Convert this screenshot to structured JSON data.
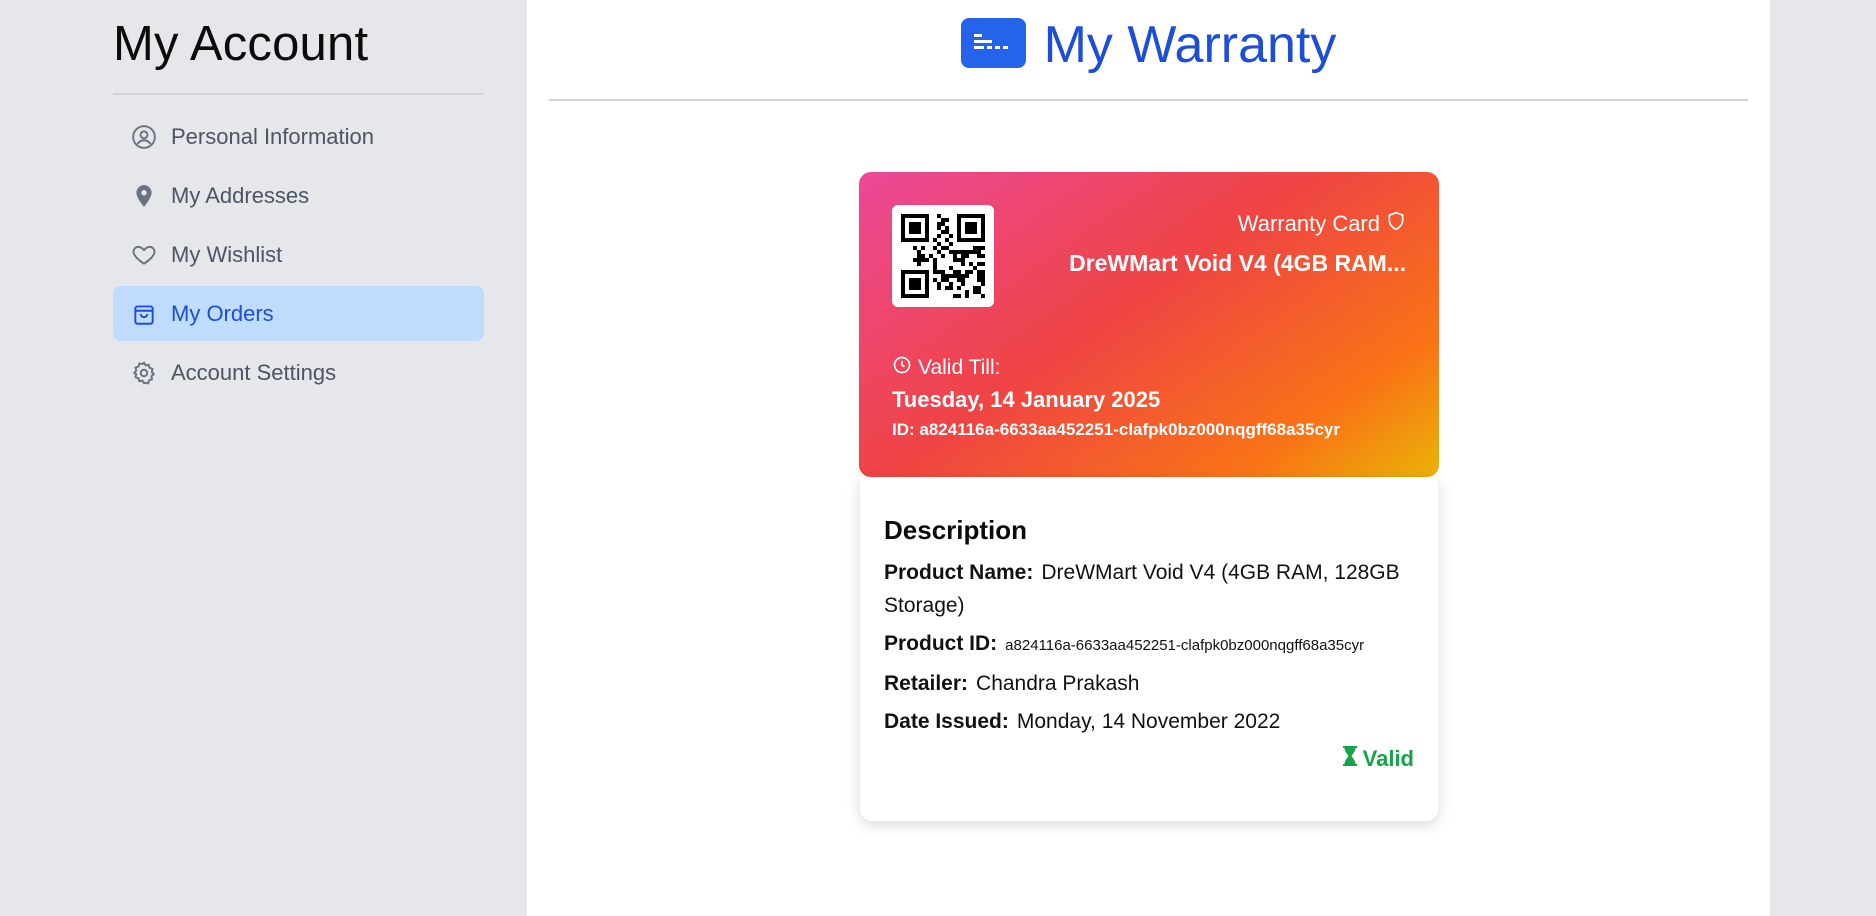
{
  "sidebar": {
    "title": "My Account",
    "items": [
      {
        "label": "Personal Information",
        "icon": "user-circle-icon"
      },
      {
        "label": "My Addresses",
        "icon": "map-pin-icon"
      },
      {
        "label": "My Wishlist",
        "icon": "heart-icon"
      },
      {
        "label": "My Orders",
        "icon": "shopping-bag-icon",
        "active": true
      },
      {
        "label": "Account Settings",
        "icon": "gear-icon"
      }
    ]
  },
  "header": {
    "title": "My Warranty",
    "icon": "card-icon"
  },
  "card": {
    "label": "Warranty Card",
    "product": "DreWMart Void V4 (4GB RAM...",
    "valid_till_label": "Valid Till:",
    "valid_till_date": "Tuesday, 14 January 2025",
    "id_text": "ID: a824116a-6633aa452251-clafpk0bz000nqgff68a35cyr"
  },
  "description": {
    "heading": "Description",
    "product_name_label": "Product Name:",
    "product_name": "DreWMart Void V4 (4GB RAM, 128GB Storage)",
    "product_id_label": "Product ID:",
    "product_id": "a824116a-6633aa452251-clafpk0bz000nqgff68a35cyr",
    "retailer_label": "Retailer:",
    "retailer": "Chandra Prakash",
    "date_issued_label": "Date Issued:",
    "date_issued": "Monday, 14 November 2022",
    "status": "Valid"
  },
  "colors": {
    "accent": "#1d4ed8",
    "active_bg": "#bfdbfe",
    "status_valid": "#16a34a"
  }
}
